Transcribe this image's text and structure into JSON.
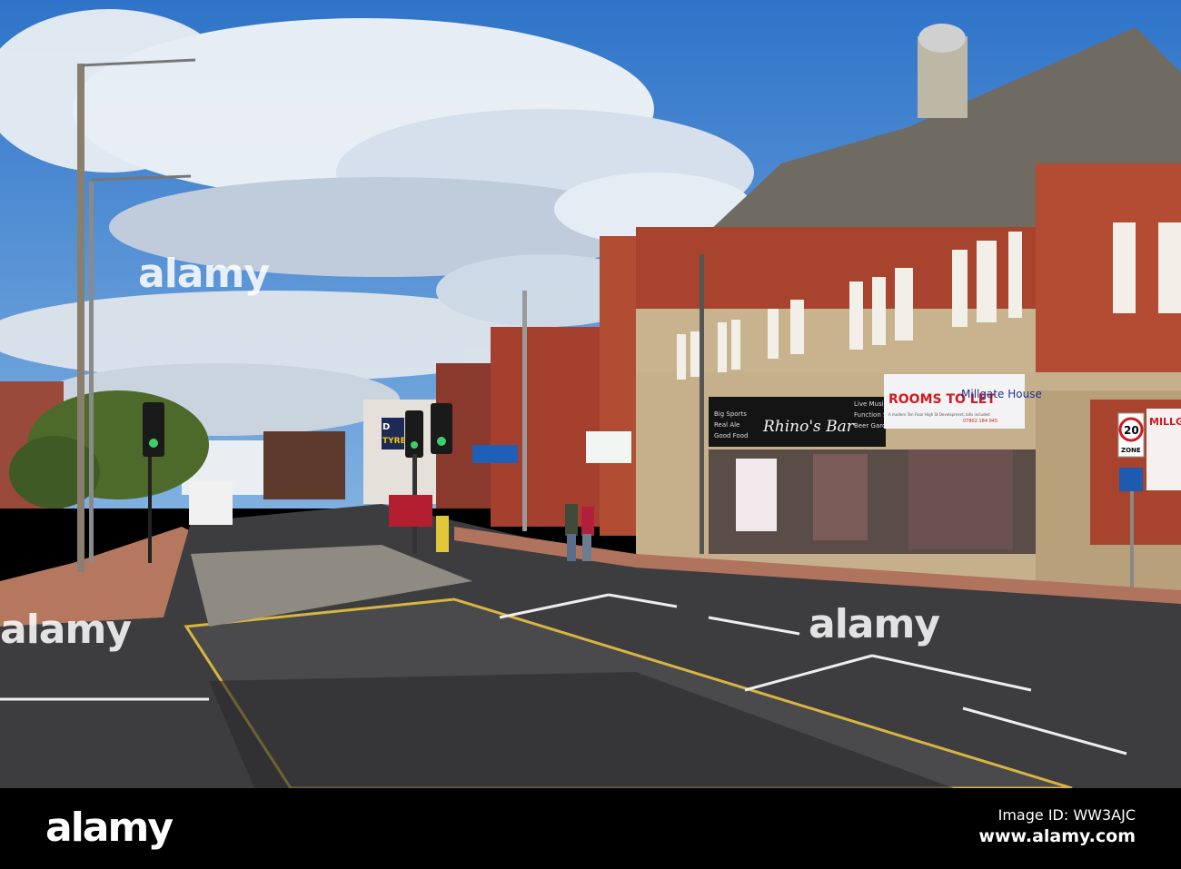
{
  "photo": {
    "signs": {
      "rooms_to_let": "ROOMS TO LET",
      "millgate_house": "Millgate House",
      "rooms_small_1": "A modern Ten Floor High St Development, bills included",
      "rooms_phone": "07802 184 945",
      "bar_name": "Rhino's Bar",
      "bar_left": [
        "Big Sports",
        "Real Ale",
        "Good Food"
      ],
      "bar_right": [
        "Live Music",
        "Function Suite",
        "Beer Garden"
      ],
      "speed_limit": "20",
      "speed_zone": "ZONE",
      "millgate_side": "MILLG",
      "tyres": "TYRE",
      "dl": "D"
    }
  },
  "watermarks": [
    "alamy",
    "alamy",
    "alamy"
  ],
  "footer": {
    "logo": "alamy",
    "image_id": "Image ID: WW3AJC",
    "url": "www.alamy.com"
  }
}
